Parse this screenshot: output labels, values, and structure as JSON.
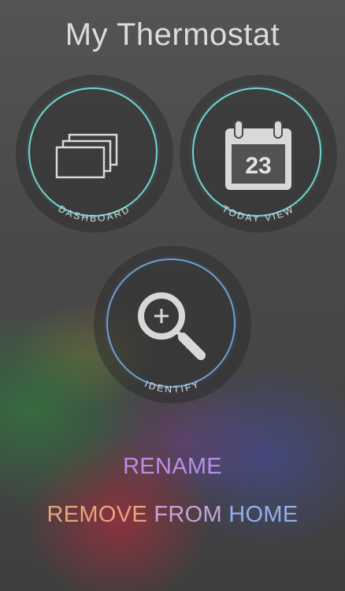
{
  "header": {
    "title": "My Thermostat"
  },
  "tiles": {
    "dashboard": {
      "label": "DASHBOARD",
      "icon": "stacked-windows-icon"
    },
    "today_view": {
      "label": "TODAY VIEW",
      "icon": "calendar-icon",
      "calendar_day": "23"
    },
    "identify": {
      "label": "IDENTIFY",
      "icon": "magnifier-plus-icon"
    }
  },
  "actions": {
    "rename": "RENAME",
    "remove_word1": "REMOVE",
    "remove_word2": "FROM",
    "remove_word3": "HOME"
  },
  "colors": {
    "ring_teal": "#6fd6d2",
    "ring_blue": "#6f9fd6",
    "text": "#dcdcdc"
  }
}
